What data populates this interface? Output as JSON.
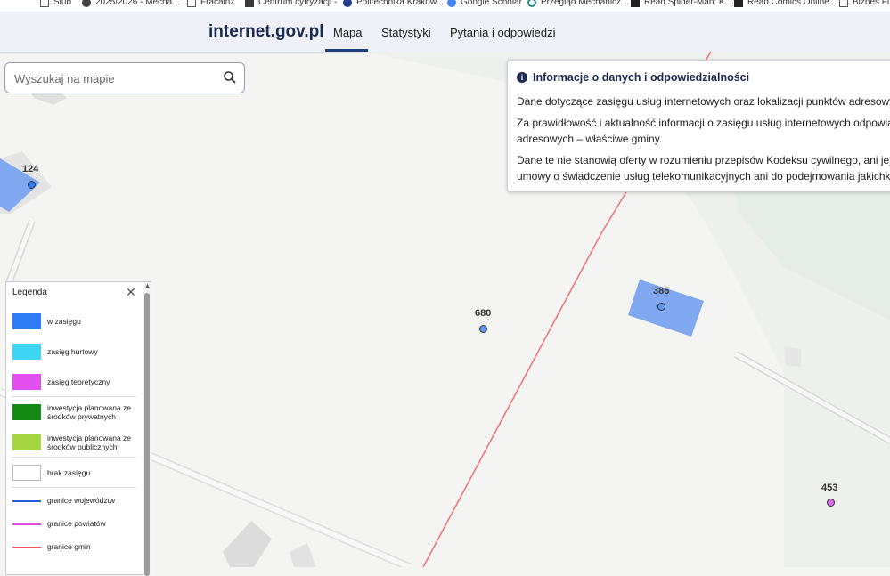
{
  "bookmarks": [
    {
      "label": "Slub",
      "icon": "page-icon"
    },
    {
      "label": "2025/2026 - Mecha...",
      "icon": "globe-icon"
    },
    {
      "label": "Fracainz",
      "icon": "page-icon"
    },
    {
      "label": "Centrum cyfryzacji -",
      "icon": "image-icon"
    },
    {
      "label": "Politechnika Krakow...",
      "icon": "globe-icon"
    },
    {
      "label": "Google Scholar",
      "icon": "scholar-icon"
    },
    {
      "label": "Przegląd Mechanicz...",
      "icon": "gear-icon"
    },
    {
      "label": "Read Spider-Man: K...",
      "icon": "comic-icon"
    },
    {
      "label": "Read Comics Online...",
      "icon": "comic-icon"
    },
    {
      "label": "Biznes Fi",
      "icon": "page-icon"
    }
  ],
  "header": {
    "brand": "internet.gov.pl",
    "tabs": [
      "Mapa",
      "Statystyki",
      "Pytania i odpowiedzi"
    ],
    "active_tab": "Mapa"
  },
  "search": {
    "placeholder": "Wyszukaj na mapie",
    "icon": "search-icon"
  },
  "info": {
    "title": "Informacje o danych i odpowiedzialności",
    "icon": "info-icon",
    "paragraphs": [
      "Dane dotyczące zasięgu usług internetowych oraz lokalizacji punktów adresowy",
      "Za prawidłowość i aktualność informacji o zasięgu usług internetowych odpowia",
      "adresowych – właściwe gminy.",
      "Dane te nie stanowią oferty w rozumieniu przepisów Kodeksu cywilnego, ani jej",
      "umowy o świadczenie usług telekomunikacyjnych ani do podejmowania jakichko"
    ]
  },
  "map": {
    "addresses": [
      "124",
      "680",
      "386",
      "453"
    ]
  },
  "legend": {
    "title": "Legenda",
    "items": [
      {
        "label": "w zasięgu",
        "color": "#2f7df6",
        "kind": "fill"
      },
      {
        "label": "zasięg hurtowy",
        "color": "#3fd6f6",
        "kind": "fill"
      },
      {
        "label": "zasięg teoretyczny",
        "color": "#e24ef0",
        "kind": "fill"
      },
      {
        "label": "inwestycja planowana ze środków prywatnych",
        "color": "#148a14",
        "kind": "fill"
      },
      {
        "label": "inwestycja planowana ze środków publicznych",
        "color": "#a6d63f",
        "kind": "fill"
      },
      {
        "label": "brak zasięgu",
        "color": "#ffffff",
        "kind": "fill"
      },
      {
        "label": "granice województw",
        "color": "#1f5fd6",
        "kind": "line"
      },
      {
        "label": "granice powiatów",
        "color": "#e04ee0",
        "kind": "line"
      },
      {
        "label": "granice gmin",
        "color": "#f05050",
        "kind": "line"
      }
    ]
  }
}
